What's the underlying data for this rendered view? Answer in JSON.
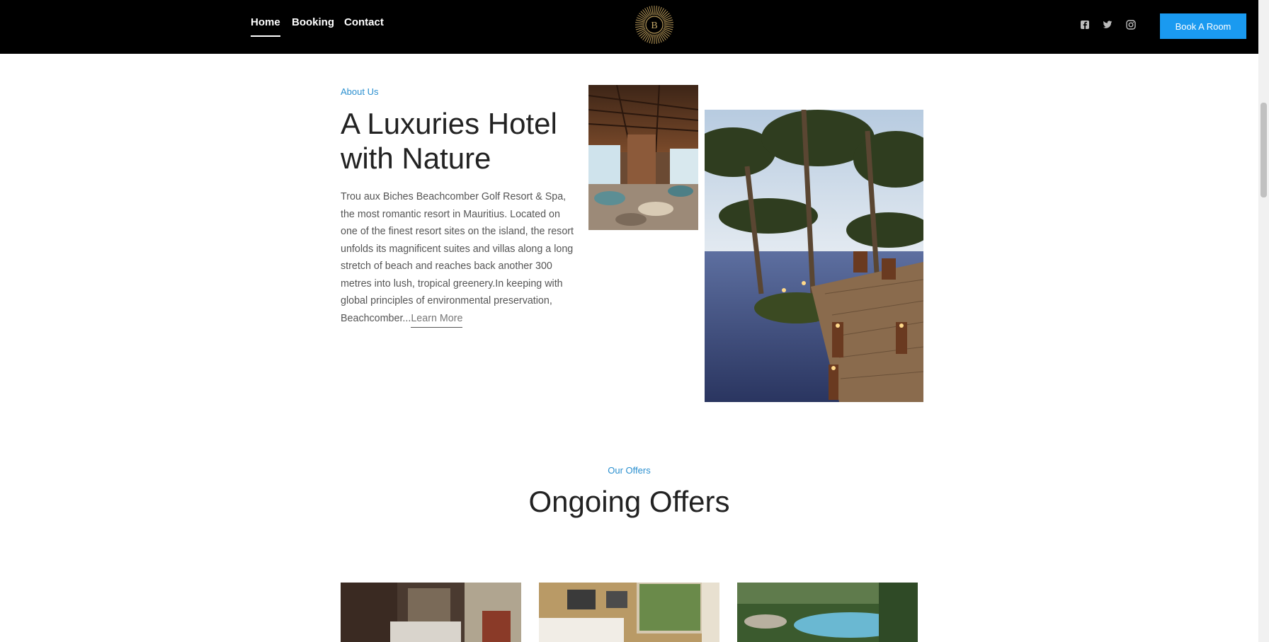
{
  "nav": {
    "links": [
      {
        "label": "Home",
        "active": true
      },
      {
        "label": "Booking",
        "active": false
      },
      {
        "label": "Contact",
        "active": false
      }
    ],
    "logo_letter": "B",
    "social_icons": [
      "facebook-icon",
      "twitter-icon",
      "instagram-icon"
    ],
    "cta_label": "Book A Room",
    "accent_color": "#1a9af0"
  },
  "about": {
    "eyebrow": "About Us",
    "title": "A Luxuries Hotel with Nature",
    "body": "Trou aux Biches Beachcomber Golf Resort & Spa, the most romantic resort in Mauritius. Located on one of the finest resort sites on the island, the resort unfolds its magnificent suites and villas along a long stretch of beach and reaches back another 300 metres into lush, tropical greenery.In keeping with global principles of environmental preservation, Beachcomber...",
    "link_label": "Learn More"
  },
  "offers": {
    "eyebrow": "Our Offers",
    "title": "Ongoing Offers"
  }
}
